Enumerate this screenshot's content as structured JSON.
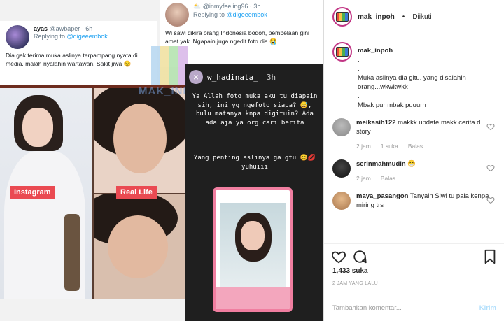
{
  "tweet1": {
    "name": "ayas",
    "handle": "@awbaper · 6h",
    "replying": "Replying to",
    "reply_to": "@digeeembok",
    "text": "Dia gak terima muka aslinya terpampang nyata di media, malah nyalahin wartawan. Sakit jiwa 😒"
  },
  "tweet2": {
    "name": "🌥️",
    "handle": "@inmyfeeling96 · 3h",
    "replying": "Replying to",
    "reply_to": "@digeeembok",
    "text": "Wi sawi dikira orang Indonesia bodoh, pembelaan gini amat yak. Ngapain juga ngedit foto dia 😭"
  },
  "photo": {
    "label_left": "Instagram",
    "label_right": "Real Life",
    "watermark": "MAK_INPO"
  },
  "story": {
    "close": "×",
    "user": "w_hadinata_",
    "time": "3h",
    "text": "Ya Allah foto muka aku tu diapain sih, ini yg ngefoto siapa? 😅, bulu matanya knpa digituin? Ada ada aja ya org cari berita",
    "text2": "Yang penting aslinya ga gtu 😊💋 yuhuiii"
  },
  "header": {
    "username": "mak_inpoh",
    "dot": "•",
    "follow_status": "Diikuti"
  },
  "caption": {
    "username": "mak_inpoh",
    "lines": [
      ".",
      ".",
      "Muka aslinya dia gitu. yang disalahin orang...wkwkwkk",
      ".",
      "Mbak pur mbak puuurrr"
    ],
    "time": "2 jam"
  },
  "comments": [
    {
      "username": "meikasih122",
      "text": "makkk update makk cerita d story",
      "time": "2 jam",
      "likes": "1 suka",
      "reply": "Balas"
    },
    {
      "username": "serinmahmudin",
      "text": "😁",
      "time": "2 jam",
      "likes": "",
      "reply": "Balas"
    },
    {
      "username": "maya_pasangon",
      "text": "Tanyain Siwi tu pala kenpa miring trs",
      "time": "",
      "likes": "",
      "reply": ""
    }
  ],
  "likes": "1,433 suka",
  "post_time": "2 JAM YANG LALU",
  "add_comment": {
    "placeholder": "Tambahkan komentar...",
    "send": "Kirim"
  }
}
